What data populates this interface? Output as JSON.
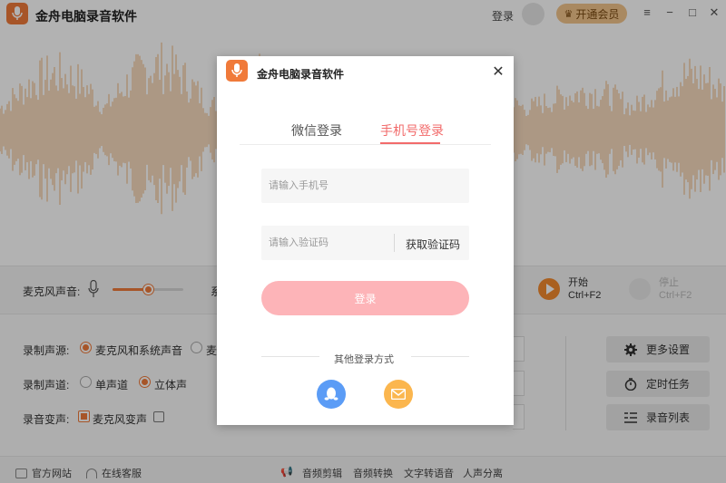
{
  "app": {
    "title": "金舟电脑录音软件",
    "login_label": "登录",
    "vip_label": "开通会员",
    "window_controls": [
      "menu-icon",
      "minimize-icon",
      "maximize-icon",
      "close-icon"
    ]
  },
  "control_bar": {
    "mic_label": "麦克风声音:",
    "mic_level": 0.5,
    "system_label_partial": "系",
    "start_label": "开始",
    "start_hotkey": "Ctrl+F2",
    "stop_label": "停止",
    "stop_hotkey": "Ctrl+F2"
  },
  "settings": {
    "source_label": "录制声源:",
    "source_options": [
      "麦克风和系统声音",
      "麦"
    ],
    "source_selected": 0,
    "channel_label": "录制声道:",
    "channel_options": [
      "单声道",
      "立体声"
    ],
    "channel_selected": 1,
    "voice_change_label": "录音变声:",
    "voice_change_option": "麦克风变声",
    "voice_change_checked": true
  },
  "side_buttons": [
    {
      "label": "更多设置",
      "icon": "gear-icon"
    },
    {
      "label": "定时任务",
      "icon": "timer-icon"
    },
    {
      "label": "录音列表",
      "icon": "list-icon"
    }
  ],
  "statusbar": {
    "left_items": [
      {
        "label": "官方网站",
        "icon": "monitor-icon"
      },
      {
        "label": "在线客服",
        "icon": "headset-icon"
      }
    ],
    "tools": [
      "音频剪辑",
      "音频转换",
      "文字转语音",
      "人声分离"
    ]
  },
  "dialog": {
    "title": "金舟电脑录音软件",
    "tabs": [
      "微信登录",
      "手机号登录"
    ],
    "active_tab": 1,
    "phone_placeholder": "请输入手机号",
    "code_placeholder": "请输入验证码",
    "get_code_label": "获取验证码",
    "login_button": "登录",
    "other_methods": "其他登录方式",
    "social": [
      {
        "name": "qq",
        "icon": "qq-icon",
        "color": "#5b9cf6"
      },
      {
        "name": "email",
        "icon": "mail-icon",
        "color": "#fbb64e"
      }
    ]
  },
  "colors": {
    "accent": "#f07a3a",
    "waveform": "#f2c79b",
    "login_button": "#fdb4b8",
    "active_tab": "#f26b6b",
    "vip_button": "#f3c58c"
  }
}
